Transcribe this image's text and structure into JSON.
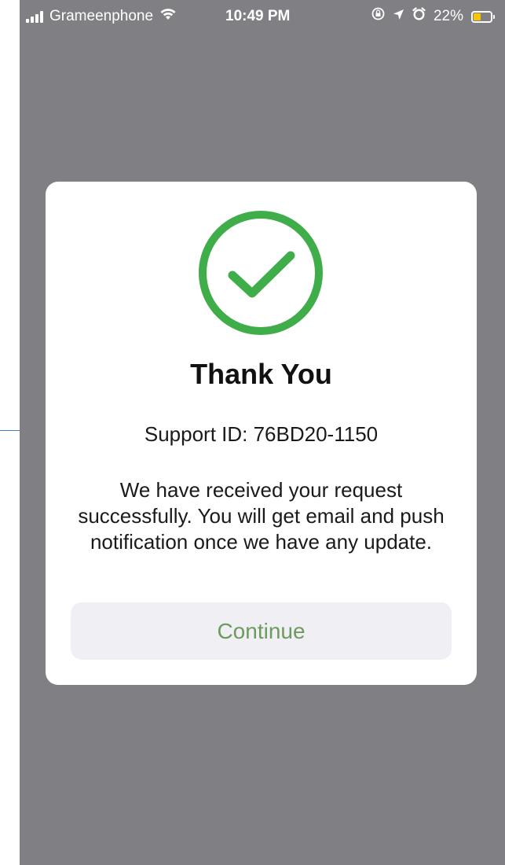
{
  "status_bar": {
    "carrier": "Grameenphone",
    "time": "10:49 PM",
    "battery_percent": "22%",
    "battery_level": 0.22,
    "icons": [
      "signal-icon",
      "wifi-icon",
      "screen-lock-icon",
      "location-icon",
      "alarm-icon",
      "battery-icon"
    ]
  },
  "dialog": {
    "icon": "checkmark-circle-icon",
    "title": "Thank You",
    "support_id": "Support ID: 76BD20-1150",
    "message": "We have received your request successfully. You will get email and push notification once we have any update.",
    "continue_label": "Continue"
  },
  "colors": {
    "overlay": "#807f84",
    "success_green": "#3fae4a",
    "button_text": "#6d9a5e",
    "button_bg": "#efeff4",
    "battery_low": "#f7c600",
    "annotation": "#3d7fc1"
  }
}
